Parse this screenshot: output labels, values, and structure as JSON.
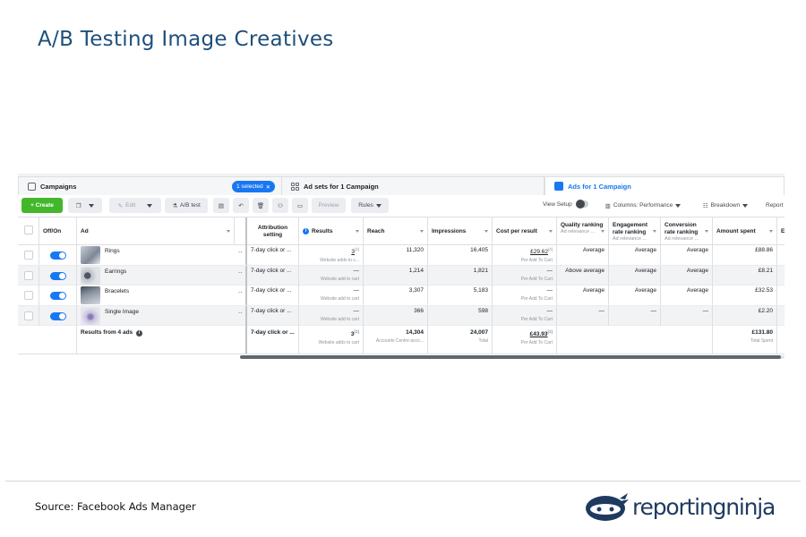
{
  "slide": {
    "title": "A/B Testing Image Creatives",
    "source": "Source: Facebook Ads Manager",
    "logo_text": "reportingninja"
  },
  "tabs": {
    "campaigns": "Campaigns",
    "selected_pill": "1 selected",
    "adsets": "Ad sets for 1 Campaign",
    "ads": "Ads for 1 Campaign"
  },
  "toolbar": {
    "create": "+ Create",
    "edit": "Edit",
    "ab_test": "A/B test",
    "preview": "Preview",
    "rules": "Rules",
    "view_setup": "View Setup",
    "columns": "Columns: Performance",
    "breakdown": "Breakdown",
    "reports": "Report"
  },
  "headers": {
    "off_on": "Off/On",
    "ad": "Ad",
    "attribution": "Attribution setting",
    "results": "Results",
    "reach": "Reach",
    "impressions": "Impressions",
    "cost_per_result": "Cost per result",
    "quality_ranking": "Quality ranking",
    "quality_sub": "Ad relevance ...",
    "engagement_ranking": "Engagement rate ranking",
    "engagement_sub": "Ad relevance ...",
    "conversion_ranking": "Conversion rate ranking",
    "conversion_sub": "Ad relevance ...",
    "amount_spent": "Amount spent",
    "cut_off": "E"
  },
  "rows": [
    {
      "ad": "Rings",
      "attribution": "7-day click or ...",
      "results": "3",
      "results_sub": "Website adds to c...",
      "reach": "11,320",
      "impressions": "16,405",
      "cost": "£29.62",
      "cost_sub": "Per Add To Cart",
      "quality": "Average",
      "engagement": "Average",
      "conversion": "Average",
      "spent": "£88.86"
    },
    {
      "ad": "Earrings",
      "attribution": "7-day click or ...",
      "results": "—",
      "results_sub": "Website add to cart",
      "reach": "1,214",
      "impressions": "1,821",
      "cost": "—",
      "cost_sub": "Per Add To Cart",
      "quality": "Above average",
      "engagement": "Average",
      "conversion": "Average",
      "spent": "£8.21"
    },
    {
      "ad": "Bracelets",
      "attribution": "7-day click or ...",
      "results": "—",
      "results_sub": "Website add to cart",
      "reach": "3,307",
      "impressions": "5,183",
      "cost": "—",
      "cost_sub": "Per Add To Cart",
      "quality": "Average",
      "engagement": "Average",
      "conversion": "Average",
      "spent": "£32.53"
    },
    {
      "ad": "Single Image",
      "attribution": "7-day click or ...",
      "results": "—",
      "results_sub": "Website add to cart",
      "reach": "366",
      "impressions": "598",
      "cost": "—",
      "cost_sub": "Per Add To Cart",
      "quality": "—",
      "engagement": "—",
      "conversion": "—",
      "spent": "£2.20"
    }
  ],
  "totals": {
    "label": "Results from 4 ads",
    "attribution": "7-day click or ...",
    "results": "3",
    "results_sub": "Website adds to cart",
    "reach": "14,304",
    "reach_sub": "Accounts Centre acco...",
    "impressions": "24,007",
    "impressions_sub": "Total",
    "cost": "£43.93",
    "cost_sub": "Per Add To Cart",
    "spent": "£131.80",
    "spent_sub": "Total Spent"
  },
  "colors": {
    "title": "#1d4f7c",
    "fb_blue": "#1877f2",
    "create_green": "#42b72a"
  }
}
